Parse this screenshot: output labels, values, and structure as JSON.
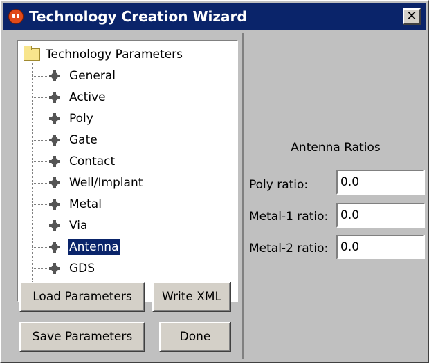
{
  "window": {
    "title": "Technology Creation Wizard",
    "close_glyph": "✕"
  },
  "tree": {
    "root_label": "Technology Parameters",
    "items": [
      {
        "label": "General",
        "selected": false
      },
      {
        "label": "Active",
        "selected": false
      },
      {
        "label": "Poly",
        "selected": false
      },
      {
        "label": "Gate",
        "selected": false
      },
      {
        "label": "Contact",
        "selected": false
      },
      {
        "label": "Well/Implant",
        "selected": false
      },
      {
        "label": "Metal",
        "selected": false
      },
      {
        "label": "Via",
        "selected": false
      },
      {
        "label": "Antenna",
        "selected": true
      },
      {
        "label": "GDS",
        "selected": false
      }
    ]
  },
  "buttons": {
    "load": "Load Parameters",
    "write_xml": "Write XML",
    "save": "Save Parameters",
    "done": "Done"
  },
  "antenna": {
    "title": "Antenna Ratios",
    "fields": [
      {
        "label": "Poly ratio:",
        "value": "0.0"
      },
      {
        "label": "Metal-1 ratio:",
        "value": "0.0"
      },
      {
        "label": "Metal-2 ratio:",
        "value": "0.0"
      }
    ]
  },
  "colors": {
    "titlebar": "#0a246a",
    "selection": "#0a246a",
    "face": "#c0c0c0"
  }
}
